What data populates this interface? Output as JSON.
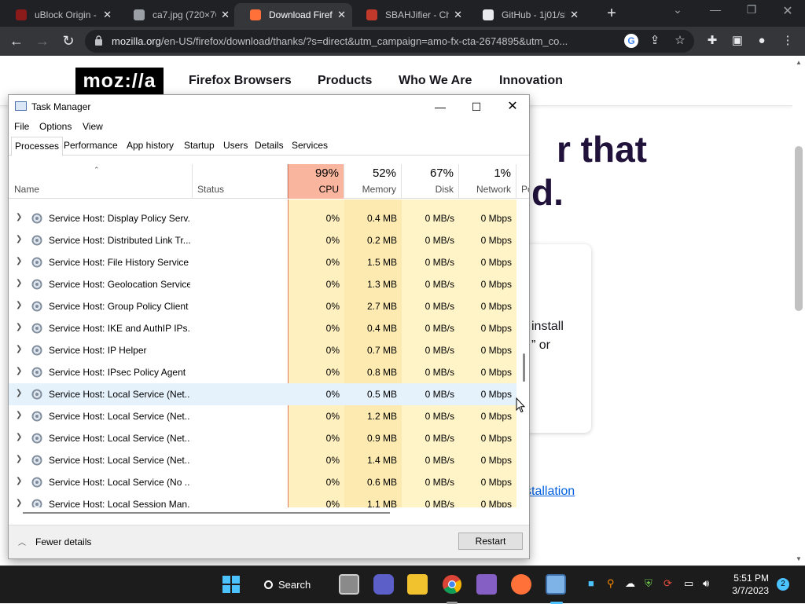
{
  "browser": {
    "tabs": [
      {
        "title": "uBlock Origin - F",
        "active": false,
        "favicon_color": "#8b1a1a"
      },
      {
        "title": "ca7.jpg (720×70",
        "active": false,
        "favicon_color": "#9aa0a6"
      },
      {
        "title": "Download Firefo",
        "active": true,
        "favicon_color": "#ff7139"
      },
      {
        "title": "SBAHJifier - Chr",
        "active": false,
        "favicon_color": "#c0392b"
      },
      {
        "title": "GitHub - 1j01/sb",
        "active": false,
        "favicon_color": "#e8eaed"
      }
    ],
    "url_host": "mozilla.org",
    "url_path": "/en-US/firefox/download/thanks/?s=direct&utm_campaign=amo-fx-cta-2674895&utm_co..."
  },
  "webpage": {
    "logo": "moz://a",
    "nav": [
      "Firefox Browsers",
      "Products",
      "Who We Are",
      "Innovation"
    ],
    "headline_line1": "r that",
    "headline_line2": "d.",
    "card_line1": "install",
    "card_line2": "” or",
    "link_text": "stallation"
  },
  "taskmgr": {
    "title": "Task Manager",
    "menus": [
      "File",
      "Options",
      "View"
    ],
    "tabs": [
      "Processes",
      "Performance",
      "App history",
      "Startup",
      "Users",
      "Details",
      "Services"
    ],
    "selected_tab": "Processes",
    "columns": {
      "name": "Name",
      "status": "Status",
      "cpu": {
        "percent": "99%",
        "label": "CPU"
      },
      "memory": {
        "percent": "52%",
        "label": "Memory"
      },
      "disk": {
        "percent": "67%",
        "label": "Disk"
      },
      "network": {
        "percent": "1%",
        "label": "Network"
      },
      "power": "Po"
    },
    "rows": [
      {
        "name": "Service Host: Display Policy Serv...",
        "cpu": "0%",
        "memory": "0.4 MB",
        "disk": "0 MB/s",
        "network": "0 Mbps"
      },
      {
        "name": "Service Host: Distributed Link Tr...",
        "cpu": "0%",
        "memory": "0.2 MB",
        "disk": "0 MB/s",
        "network": "0 Mbps"
      },
      {
        "name": "Service Host: File History Service",
        "cpu": "0%",
        "memory": "1.5 MB",
        "disk": "0 MB/s",
        "network": "0 Mbps"
      },
      {
        "name": "Service Host: Geolocation Service",
        "cpu": "0%",
        "memory": "1.3 MB",
        "disk": "0 MB/s",
        "network": "0 Mbps"
      },
      {
        "name": "Service Host: Group Policy Client",
        "cpu": "0%",
        "memory": "2.7 MB",
        "disk": "0 MB/s",
        "network": "0 Mbps"
      },
      {
        "name": "Service Host: IKE and AuthIP IPs...",
        "cpu": "0%",
        "memory": "0.4 MB",
        "disk": "0 MB/s",
        "network": "0 Mbps"
      },
      {
        "name": "Service Host: IP Helper",
        "cpu": "0%",
        "memory": "0.7 MB",
        "disk": "0 MB/s",
        "network": "0 Mbps"
      },
      {
        "name": "Service Host: IPsec Policy Agent",
        "cpu": "0%",
        "memory": "0.8 MB",
        "disk": "0 MB/s",
        "network": "0 Mbps"
      },
      {
        "name": "Service Host: Local Service (Net...",
        "cpu": "0%",
        "memory": "0.5 MB",
        "disk": "0 MB/s",
        "network": "0 Mbps",
        "highlighted": true
      },
      {
        "name": "Service Host: Local Service (Net...",
        "cpu": "0%",
        "memory": "1.2 MB",
        "disk": "0 MB/s",
        "network": "0 Mbps"
      },
      {
        "name": "Service Host: Local Service (Net...",
        "cpu": "0%",
        "memory": "0.9 MB",
        "disk": "0 MB/s",
        "network": "0 Mbps"
      },
      {
        "name": "Service Host: Local Service (Net...",
        "cpu": "0%",
        "memory": "1.4 MB",
        "disk": "0 MB/s",
        "network": "0 Mbps"
      },
      {
        "name": "Service Host: Local Service (No ...",
        "cpu": "0%",
        "memory": "0.6 MB",
        "disk": "0 MB/s",
        "network": "0 Mbps"
      },
      {
        "name": "Service Host: Local Session Man...",
        "cpu": "0%",
        "memory": "1.1 MB",
        "disk": "0 MB/s",
        "network": "0 Mbps"
      }
    ],
    "fewer_details": "Fewer details",
    "restart": "Restart"
  },
  "taskbar": {
    "search": "Search",
    "time": "5:51 PM",
    "date": "3/7/2023",
    "notification_count": "2"
  },
  "colors": {
    "cpu_header": "#f9b59d",
    "cpu_column": "#fff0c0",
    "memory_column": "#fdeab0",
    "accent_link": "#0060df",
    "row_highlight": "#e5f1fb"
  }
}
